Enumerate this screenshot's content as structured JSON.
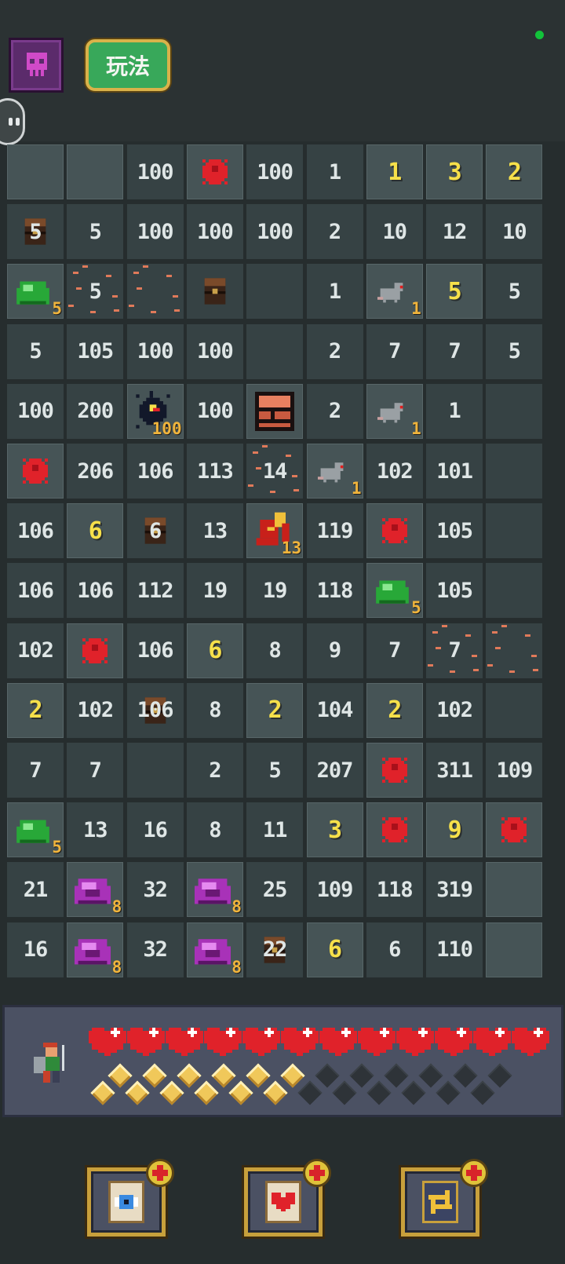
{
  "header": {
    "howto_label": "玩法"
  },
  "colors": {
    "cell_hidden": "#364244",
    "cell_revealed": "#465456",
    "number": "#dfe6e6",
    "yellow_number": "#f6e04a",
    "badge": "#f0b43c",
    "heart": "#e0222a"
  },
  "board": {
    "cols": 9,
    "rows": [
      [
        {
          "t": "blank",
          "r": true
        },
        {
          "t": "blank",
          "r": true
        },
        {
          "t": "num",
          "v": "100"
        },
        {
          "t": "mine",
          "r": true
        },
        {
          "t": "num",
          "v": "100"
        },
        {
          "t": "num",
          "v": "1"
        },
        {
          "t": "ynum",
          "v": "1",
          "r": true
        },
        {
          "t": "ynum",
          "v": "3",
          "r": true
        },
        {
          "t": "ynum",
          "v": "2",
          "r": true
        }
      ],
      [
        {
          "t": "chest",
          "v": "5"
        },
        {
          "t": "num",
          "v": "5"
        },
        {
          "t": "num",
          "v": "100"
        },
        {
          "t": "num",
          "v": "100"
        },
        {
          "t": "num",
          "v": "100"
        },
        {
          "t": "num",
          "v": "2"
        },
        {
          "t": "num",
          "v": "10"
        },
        {
          "t": "num",
          "v": "12"
        },
        {
          "t": "num",
          "v": "10"
        }
      ],
      [
        {
          "t": "slime",
          "c": "green",
          "v": "5",
          "r": true
        },
        {
          "t": "rubble",
          "v": "5"
        },
        {
          "t": "rubble",
          "v": ""
        },
        {
          "t": "chest",
          "v": ""
        },
        {
          "t": "blank"
        },
        {
          "t": "num",
          "v": "1"
        },
        {
          "t": "rat",
          "v": "1",
          "r": true
        },
        {
          "t": "ynum",
          "v": "5",
          "r": true
        },
        {
          "t": "num",
          "v": "5"
        }
      ],
      [
        {
          "t": "num",
          "v": "5"
        },
        {
          "t": "num",
          "v": "105"
        },
        {
          "t": "num",
          "v": "100"
        },
        {
          "t": "num",
          "v": "100"
        },
        {
          "t": "blank"
        },
        {
          "t": "num",
          "v": "2"
        },
        {
          "t": "num",
          "v": "7"
        },
        {
          "t": "num",
          "v": "7"
        },
        {
          "t": "num",
          "v": "5"
        }
      ],
      [
        {
          "t": "num",
          "v": "100"
        },
        {
          "t": "num",
          "v": "200"
        },
        {
          "t": "orb",
          "v": "100",
          "r": true
        },
        {
          "t": "num",
          "v": "100"
        },
        {
          "t": "wall",
          "r": true
        },
        {
          "t": "num",
          "v": "2"
        },
        {
          "t": "rat",
          "v": "1",
          "r": true
        },
        {
          "t": "num",
          "v": "1"
        },
        {
          "t": "blank"
        }
      ],
      [
        {
          "t": "mine",
          "r": true
        },
        {
          "t": "num",
          "v": "206"
        },
        {
          "t": "num",
          "v": "106"
        },
        {
          "t": "num",
          "v": "113"
        },
        {
          "t": "rubble",
          "v": "14"
        },
        {
          "t": "rat",
          "v": "1",
          "r": true
        },
        {
          "t": "num",
          "v": "102"
        },
        {
          "t": "num",
          "v": "101"
        },
        {
          "t": "blank"
        }
      ],
      [
        {
          "t": "num",
          "v": "106"
        },
        {
          "t": "ynum",
          "v": "6",
          "r": true
        },
        {
          "t": "chest",
          "v": "6"
        },
        {
          "t": "num",
          "v": "13"
        },
        {
          "t": "dragon",
          "v": "13",
          "r": true
        },
        {
          "t": "num",
          "v": "119"
        },
        {
          "t": "mine",
          "r": true
        },
        {
          "t": "num",
          "v": "105"
        },
        {
          "t": "blank"
        }
      ],
      [
        {
          "t": "num",
          "v": "106"
        },
        {
          "t": "num",
          "v": "106"
        },
        {
          "t": "num",
          "v": "112"
        },
        {
          "t": "num",
          "v": "19"
        },
        {
          "t": "num",
          "v": "19"
        },
        {
          "t": "num",
          "v": "118"
        },
        {
          "t": "slime",
          "c": "green",
          "v": "5",
          "r": true
        },
        {
          "t": "num",
          "v": "105"
        },
        {
          "t": "blank"
        }
      ],
      [
        {
          "t": "num",
          "v": "102"
        },
        {
          "t": "mine",
          "r": true
        },
        {
          "t": "num",
          "v": "106"
        },
        {
          "t": "ynum",
          "v": "6",
          "r": true
        },
        {
          "t": "num",
          "v": "8"
        },
        {
          "t": "num",
          "v": "9"
        },
        {
          "t": "num",
          "v": "7"
        },
        {
          "t": "rubble",
          "v": "7"
        },
        {
          "t": "rubble",
          "v": ""
        }
      ],
      [
        {
          "t": "ynum",
          "v": "2",
          "r": true
        },
        {
          "t": "num",
          "v": "102"
        },
        {
          "t": "chest",
          "v": "106"
        },
        {
          "t": "num",
          "v": "8"
        },
        {
          "t": "ynum",
          "v": "2",
          "r": true
        },
        {
          "t": "num",
          "v": "104"
        },
        {
          "t": "ynum",
          "v": "2",
          "r": true
        },
        {
          "t": "num",
          "v": "102"
        },
        {
          "t": "blank"
        }
      ],
      [
        {
          "t": "num",
          "v": "7"
        },
        {
          "t": "num",
          "v": "7"
        },
        {
          "t": "blank"
        },
        {
          "t": "num",
          "v": "2"
        },
        {
          "t": "num",
          "v": "5"
        },
        {
          "t": "num",
          "v": "207"
        },
        {
          "t": "mine",
          "r": true
        },
        {
          "t": "num",
          "v": "311"
        },
        {
          "t": "num",
          "v": "109"
        }
      ],
      [
        {
          "t": "slime",
          "c": "green",
          "v": "5",
          "r": true
        },
        {
          "t": "num",
          "v": "13"
        },
        {
          "t": "num",
          "v": "16"
        },
        {
          "t": "num",
          "v": "8"
        },
        {
          "t": "num",
          "v": "11"
        },
        {
          "t": "ynum",
          "v": "3",
          "r": true
        },
        {
          "t": "mine",
          "r": true
        },
        {
          "t": "ynum",
          "v": "9",
          "r": true
        },
        {
          "t": "mine",
          "r": true
        }
      ],
      [
        {
          "t": "num",
          "v": "21"
        },
        {
          "t": "slime",
          "c": "purple",
          "v": "8",
          "r": true
        },
        {
          "t": "num",
          "v": "32"
        },
        {
          "t": "slime",
          "c": "purple",
          "v": "8",
          "r": true
        },
        {
          "t": "num",
          "v": "25"
        },
        {
          "t": "num",
          "v": "109"
        },
        {
          "t": "num",
          "v": "118"
        },
        {
          "t": "num",
          "v": "319"
        },
        {
          "t": "blank",
          "r": true
        }
      ],
      [
        {
          "t": "num",
          "v": "16"
        },
        {
          "t": "slime",
          "c": "purple",
          "v": "8",
          "r": true
        },
        {
          "t": "num",
          "v": "32"
        },
        {
          "t": "slime",
          "c": "purple",
          "v": "8",
          "r": true
        },
        {
          "t": "chest",
          "v": "22"
        },
        {
          "t": "ynum",
          "v": "6",
          "r": true
        },
        {
          "t": "num",
          "v": "6"
        },
        {
          "t": "num",
          "v": "110"
        },
        {
          "t": "blank",
          "r": true
        }
      ]
    ]
  },
  "player": {
    "hearts_total": 12,
    "hearts_full": 12,
    "gems_total": 24,
    "gems_full": 12
  },
  "dock": [
    {
      "icon": "eye-icon",
      "name": "reveal-card-button"
    },
    {
      "icon": "heart-icon",
      "name": "heal-card-button"
    },
    {
      "icon": "swap-arrows-icon",
      "name": "swap-card-button"
    }
  ]
}
